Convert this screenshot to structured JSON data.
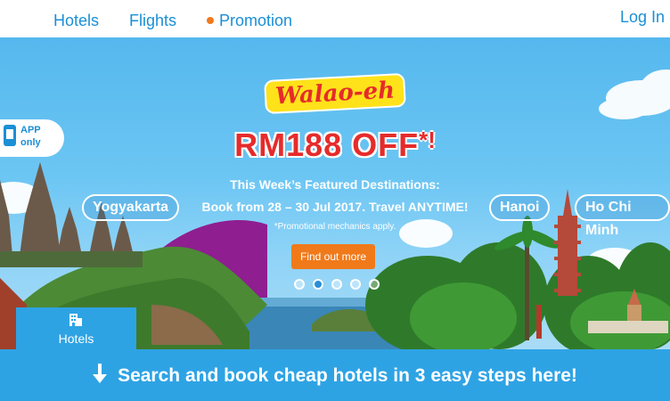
{
  "nav": {
    "hotels": "Hotels",
    "flights": "Flights",
    "promotion": "Promotion",
    "login": "Log In"
  },
  "banner": {
    "app_badge": {
      "line1": "APP",
      "line2": "only"
    },
    "brand": "Walao-eh",
    "headline": "RM188 OFF",
    "headline_mark": "*!",
    "featured": "This Week’s Featured Destinations:",
    "book_line": "Book from 28 – 30 Jul 2017. Travel ANYTIME!",
    "mechanics": "*Promotional mechanics apply.",
    "cta_button": "Find out more",
    "destinations": [
      "Yogyakarta",
      "Hanoi",
      "Ho Chi Minh"
    ],
    "carousel_active_index": 1,
    "carousel_count": 5
  },
  "tab": {
    "label": "Hotels",
    "icon": "building-icon"
  },
  "footer": {
    "cta": "Search and book cheap hotels in 3 easy steps here!",
    "icon": "arrow-down-icon"
  },
  "colors": {
    "brand_blue": "#1a8fd6",
    "orange": "#f07a1a",
    "red": "#e62b2b",
    "bar_blue": "#2ea3e4"
  }
}
